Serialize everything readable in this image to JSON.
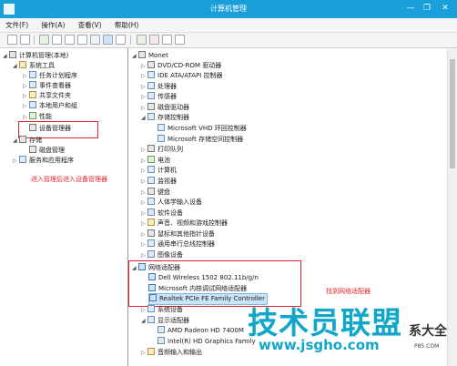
{
  "window": {
    "title": "计算机管理",
    "controls": [
      "—",
      "❐",
      "✕"
    ]
  },
  "menu": [
    "文件(F)",
    "操作(A)",
    "查看(V)",
    "帮助(H)"
  ],
  "left_tree": [
    {
      "label": "计算机管理(本地)",
      "icon": "computer-mgmt-icon",
      "arrow": "◢"
    },
    {
      "label": "系统工具",
      "icon": "tools-icon",
      "arrow": "◢"
    },
    {
      "label": "任务计划程序",
      "icon": "clock-icon",
      "arrow": "▷"
    },
    {
      "label": "事件查看器",
      "icon": "event-icon",
      "arrow": "▷"
    },
    {
      "label": "共享文件夹",
      "icon": "folder-icon",
      "arrow": "▷"
    },
    {
      "label": "本地用户和组",
      "icon": "users-icon",
      "arrow": "▷"
    },
    {
      "label": "性能",
      "icon": "perf-icon",
      "arrow": "▷"
    },
    {
      "label": "设备管理器",
      "icon": "device-manager-icon",
      "arrow": ""
    },
    {
      "label": "存储",
      "icon": "storage-icon",
      "arrow": "◢"
    },
    {
      "label": "磁盘管理",
      "icon": "disk-icon",
      "arrow": ""
    },
    {
      "label": "服务和应用程序",
      "icon": "services-icon",
      "arrow": "▷"
    }
  ],
  "left_note": "进入管理后进入设备管理器",
  "devices": [
    {
      "label": "Monet",
      "arrow": "◢"
    },
    {
      "label": "DVD/CD-ROM 驱动器",
      "arrow": "▷"
    },
    {
      "label": "IDE ATA/ATAPI 控制器",
      "arrow": "▷"
    },
    {
      "label": "处理器",
      "arrow": "▷"
    },
    {
      "label": "传感器",
      "arrow": "▷"
    },
    {
      "label": "磁盘驱动器",
      "arrow": "▷"
    },
    {
      "label": "存储控制器",
      "arrow": "◢"
    },
    {
      "label": "Microsoft VHD 环回控制器",
      "arrow": ""
    },
    {
      "label": "Microsoft 存储空间控制器",
      "arrow": ""
    },
    {
      "label": "打印队列",
      "arrow": "▷"
    },
    {
      "label": "电池",
      "arrow": "▷"
    },
    {
      "label": "计算机",
      "arrow": "▷"
    },
    {
      "label": "监视器",
      "arrow": "▷"
    },
    {
      "label": "键盘",
      "arrow": "▷"
    },
    {
      "label": "人体学输入设备",
      "arrow": "▷"
    },
    {
      "label": "软件设备",
      "arrow": "▷"
    },
    {
      "label": "声音、视频和游戏控制器",
      "arrow": "▷"
    },
    {
      "label": "鼠标和其他指针设备",
      "arrow": "▷"
    },
    {
      "label": "通用串行总线控制器",
      "arrow": "▷"
    },
    {
      "label": "图像设备",
      "arrow": "▷"
    },
    {
      "label": "网络适配器",
      "arrow": "◢"
    },
    {
      "label": "Dell Wireless 1502 802.11b/g/n",
      "arrow": ""
    },
    {
      "label": "Microsoft 内核调试网络适配器",
      "arrow": ""
    },
    {
      "label": "Realtek PCIe FE Family Controller",
      "arrow": ""
    },
    {
      "label": "系统设备",
      "arrow": "▷"
    },
    {
      "label": "显示适配器",
      "arrow": "◢"
    },
    {
      "label": "AMD Radeon HD 7400M",
      "arrow": ""
    },
    {
      "label": "Intel(R) HD Graphics Family",
      "arrow": ""
    },
    {
      "label": "音频输入和输出",
      "arrow": "▷"
    }
  ],
  "right_note": "找到网络适配器",
  "watermark": {
    "main": "技术员联盟",
    "sub": "www.jsgho.com",
    "side": "系大全",
    "tiny": "P85.COM"
  }
}
